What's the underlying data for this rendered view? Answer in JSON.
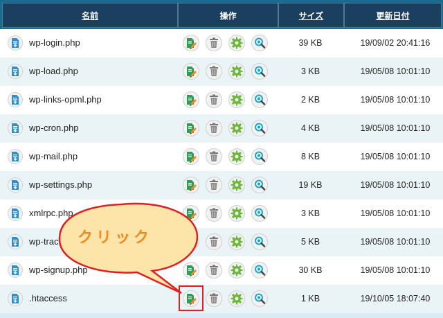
{
  "header": {
    "name": "名前",
    "ops": "操作",
    "size": "サイズ",
    "date": "更新日付"
  },
  "rows": [
    {
      "name": "wp-login.php",
      "size": "39 KB",
      "date": "19/09/02 20:41:16"
    },
    {
      "name": "wp-load.php",
      "size": "3 KB",
      "date": "19/05/08 10:01:10"
    },
    {
      "name": "wp-links-opml.php",
      "size": "2 KB",
      "date": "19/05/08 10:01:10"
    },
    {
      "name": "wp-cron.php",
      "size": "4 KB",
      "date": "19/05/08 10:01:10"
    },
    {
      "name": "wp-mail.php",
      "size": "8 KB",
      "date": "19/05/08 10:01:10"
    },
    {
      "name": "wp-settings.php",
      "size": "19 KB",
      "date": "19/05/08 10:01:10"
    },
    {
      "name": "xmlrpc.php",
      "size": "3 KB",
      "date": "19/05/08 10:01:10"
    },
    {
      "name": "wp-trackback.php",
      "size": "5 KB",
      "date": "19/05/08 10:01:10"
    },
    {
      "name": "wp-signup.php",
      "size": "30 KB",
      "date": "19/05/08 10:01:10"
    },
    {
      "name": ".htaccess",
      "size": "1 KB",
      "date": "19/10/05 18:07:40"
    }
  ],
  "icons": {
    "file": "file-download-icon",
    "edit": "edit-icon",
    "delete": "trash-icon",
    "settings": "gear-icon",
    "search": "magnifier-icon"
  },
  "callout": {
    "text": "クリック"
  },
  "colors": {
    "header_bg": "#1b3f5e",
    "callout_fill": "#fde4a8",
    "callout_border": "#e02020"
  }
}
